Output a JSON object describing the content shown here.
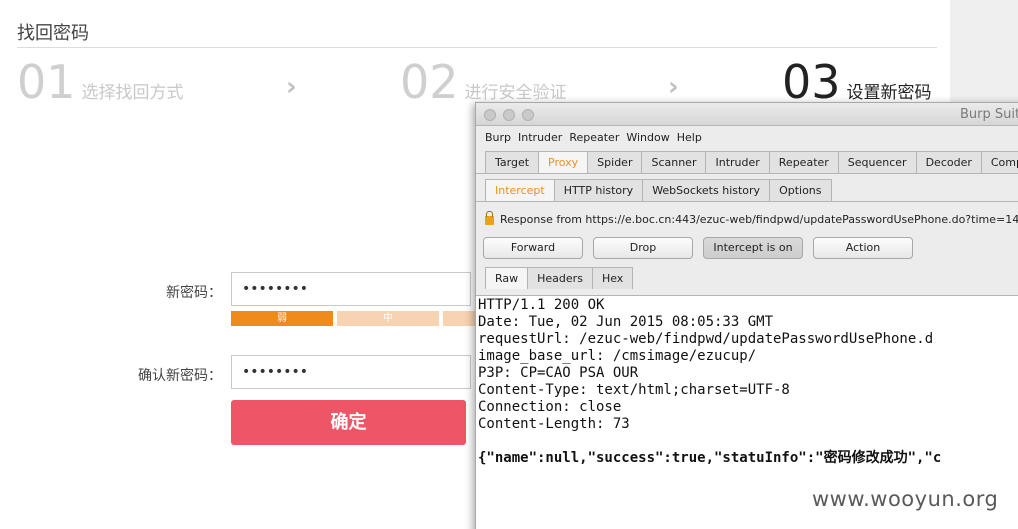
{
  "page": {
    "title": "找回密码",
    "steps": [
      {
        "num": "01",
        "label": "选择找回方式"
      },
      {
        "num": "02",
        "label": "进行安全验证"
      },
      {
        "num": "03",
        "label": "设置新密码"
      }
    ],
    "arrow": "›",
    "new_password_label": "新密码：",
    "new_password_value": "••••••••",
    "strength_weak": "弱",
    "strength_medium": "中",
    "confirm_label": "确认新密码：",
    "confirm_value": "••••••••",
    "submit_label": "确定",
    "colors": {
      "submit": "#ee5566",
      "strength_weak": "#f08a1a",
      "strength_medium": "#f7d3b2"
    }
  },
  "burp": {
    "window_title": "Burp Suite",
    "menu": [
      "Burp",
      "Intruder",
      "Repeater",
      "Window",
      "Help"
    ],
    "main_tabs": [
      "Target",
      "Proxy",
      "Spider",
      "Scanner",
      "Intruder",
      "Repeater",
      "Sequencer",
      "Decoder",
      "Comp"
    ],
    "main_tab_selected": "Proxy",
    "sub_tabs": [
      "Intercept",
      "HTTP history",
      "WebSockets history",
      "Options"
    ],
    "sub_tab_selected": "Intercept",
    "info": "Response from https://e.boc.cn:443/ezuc-web/findpwd/updatePasswordUsePhone.do?time=14",
    "buttons": {
      "forward": "Forward",
      "drop": "Drop",
      "intercept": "Intercept is on",
      "action": "Action"
    },
    "view_tabs": [
      "Raw",
      "Headers",
      "Hex"
    ],
    "view_tab_selected": "Raw",
    "response_lines": [
      "HTTP/1.1 200 OK",
      "Date: Tue, 02 Jun 2015 08:05:33 GMT",
      "requestUrl: /ezuc-web/findpwd/updatePasswordUsePhone.d",
      "image_base_url: /cmsimage/ezucup/",
      "P3P: CP=CAO PSA OUR",
      "Content-Type: text/html;charset=UTF-8",
      "Connection: close",
      "Content-Length: 73"
    ],
    "response_body": "{\"name\":null,\"success\":true,\"statuInfo\":\"密码修改成功\",\"c"
  },
  "watermark": "www.wooyun.org"
}
